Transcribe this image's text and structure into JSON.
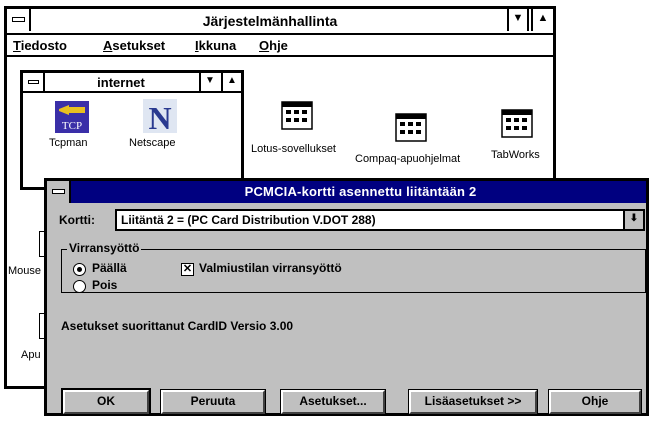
{
  "program_manager": {
    "title": "Järjestelmänhallinta",
    "menu": [
      "Tiedosto",
      "Asetukset",
      "Ikkuna",
      "Ohje"
    ],
    "group_icons": [
      "Lotus-sovellukset",
      "Compaq-apuohjelmat",
      "TabWorks"
    ],
    "partial_labels": [
      "Mouse",
      "Apu"
    ]
  },
  "internet_group": {
    "title": "internet",
    "icons": [
      {
        "label": "Tcpman",
        "icon": "tcp-icon",
        "glyph": "TCP"
      },
      {
        "label": "Netscape",
        "icon": "netscape-icon",
        "glyph": "N"
      }
    ]
  },
  "dialog": {
    "title": "PCMCIA-kortti asennettu liitäntään 2",
    "kortti_label": "Kortti:",
    "kortti_value": "Liitäntä 2 =  (PC Card Distribution V.DOT 288)",
    "power_group_label": "Virransyöttö",
    "radio_on_label": "Päällä",
    "radio_off_label": "Pois",
    "radio_selected": "Päällä",
    "standby_label": "Valmiustilan virransyöttö",
    "standby_checked": true,
    "info_text": "Asetukset suorittanut CardID Versio 3.00",
    "buttons": {
      "ok": "OK",
      "cancel": "Peruuta",
      "settings": "Asetukset...",
      "advanced": "Lisäasetukset >>",
      "help": "Ohje"
    }
  },
  "colors": {
    "dialog_title_bg": "#000080",
    "dialog_bg": "#c0c0c0"
  }
}
